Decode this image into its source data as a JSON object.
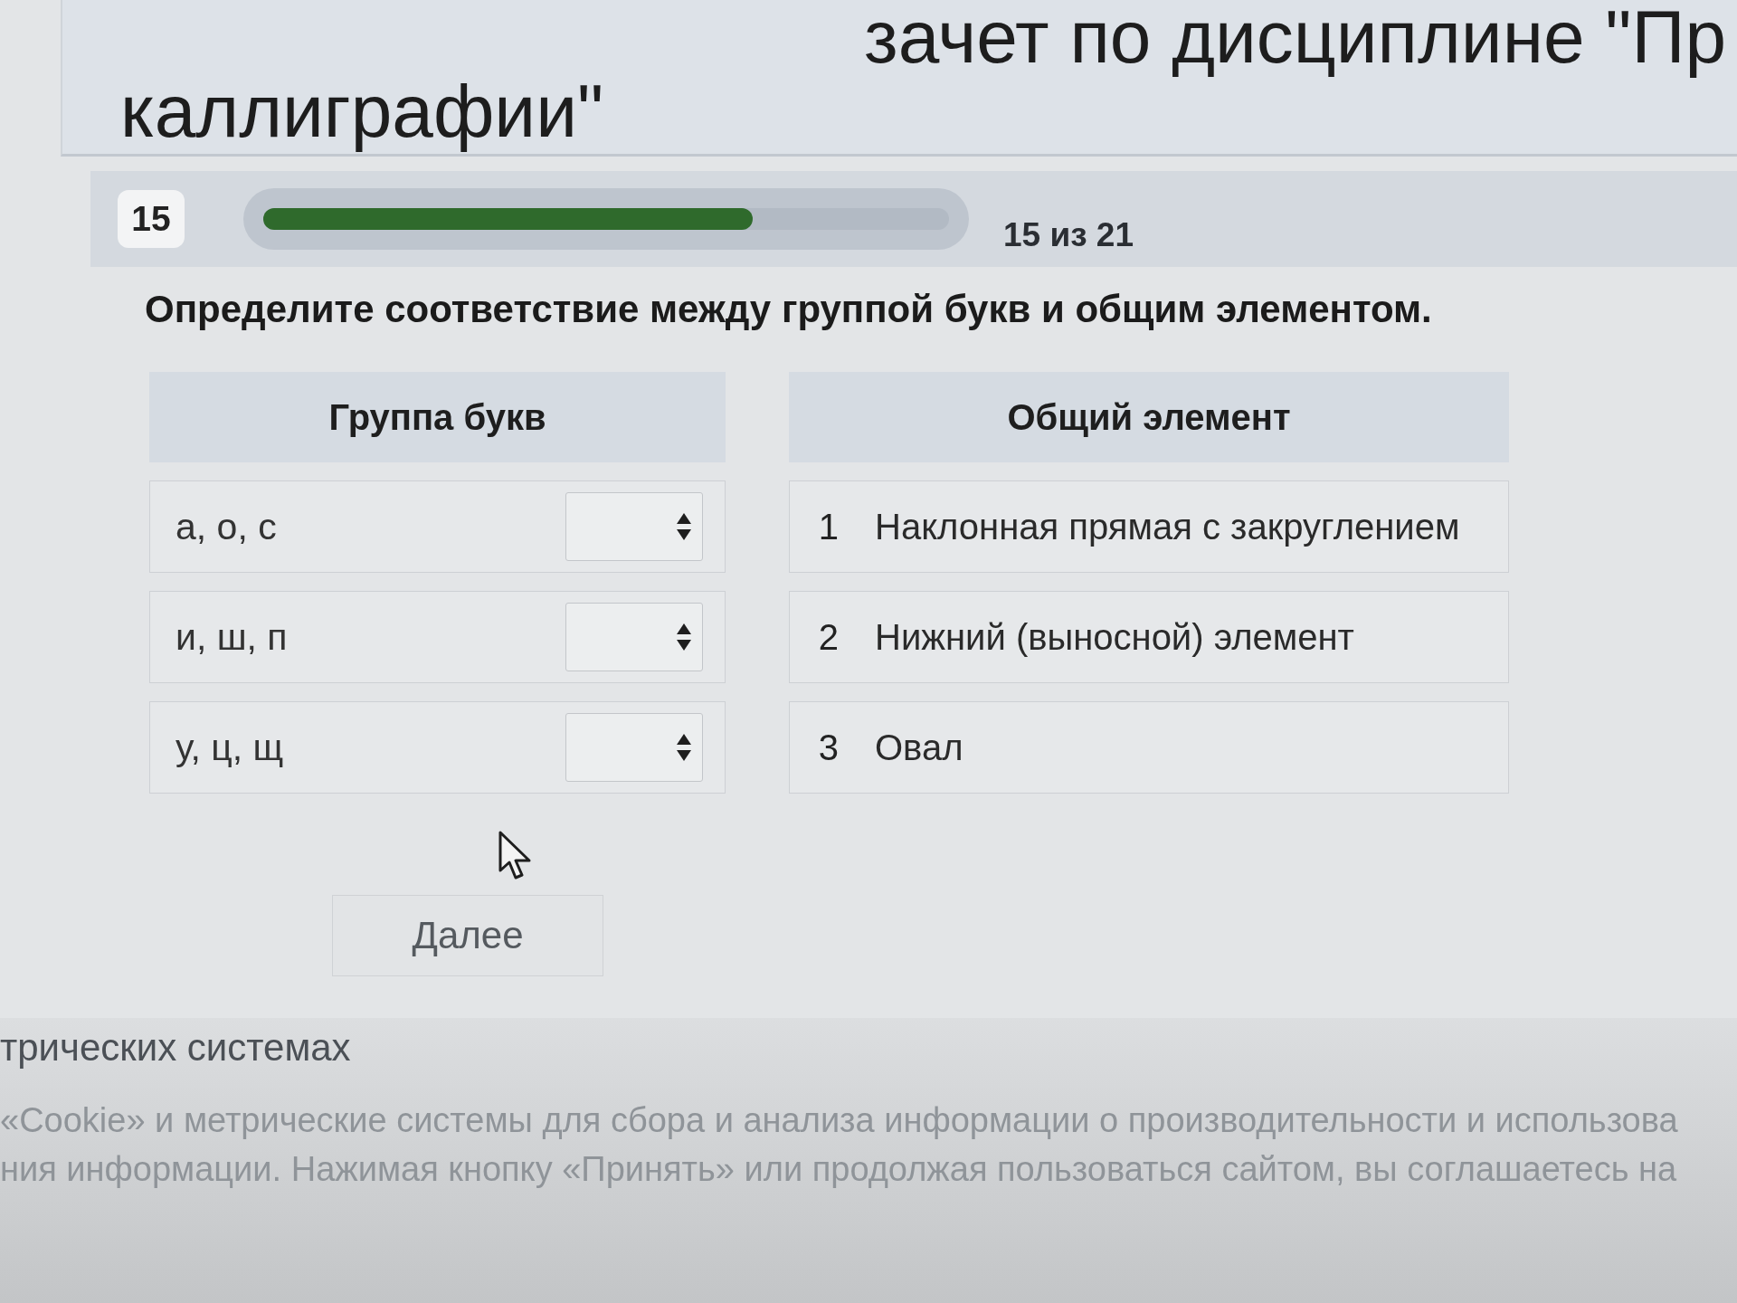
{
  "header": {
    "title_lines": [
      "зачет по дисциплине \"Пр",
      "каллиграфии\""
    ]
  },
  "progress": {
    "number": "15",
    "level": 0.714,
    "reading": "15 из 21"
  },
  "question": {
    "text": "Определите соответствие между группой букв и общим элементом."
  },
  "matching": {
    "columns": [
      "Группа букв",
      "Общий элемент"
    ],
    "left_items": [
      {
        "letters": "а, о, с"
      },
      {
        "letters": "и, ш, п"
      },
      {
        "letters": "у, ц, щ"
      }
    ],
    "right_items": [
      {
        "number": "1",
        "text": "Наклонная прямая с закруглением"
      },
      {
        "number": "2",
        "text": "Нижний (выносной) элемент"
      },
      {
        "number": "3",
        "text": "Овал"
      }
    ]
  },
  "next_button": {
    "label": "Далее"
  },
  "cookie_notice": {
    "heading": "трических системах",
    "lines": [
      "«Cookie» и метрические системы для сбора и анализа информации о производительности и использова",
      "ния информации. Нажимая кнопку «Принять» или продолжая пользоваться сайтом, вы соглашаетесь на"
    ]
  }
}
